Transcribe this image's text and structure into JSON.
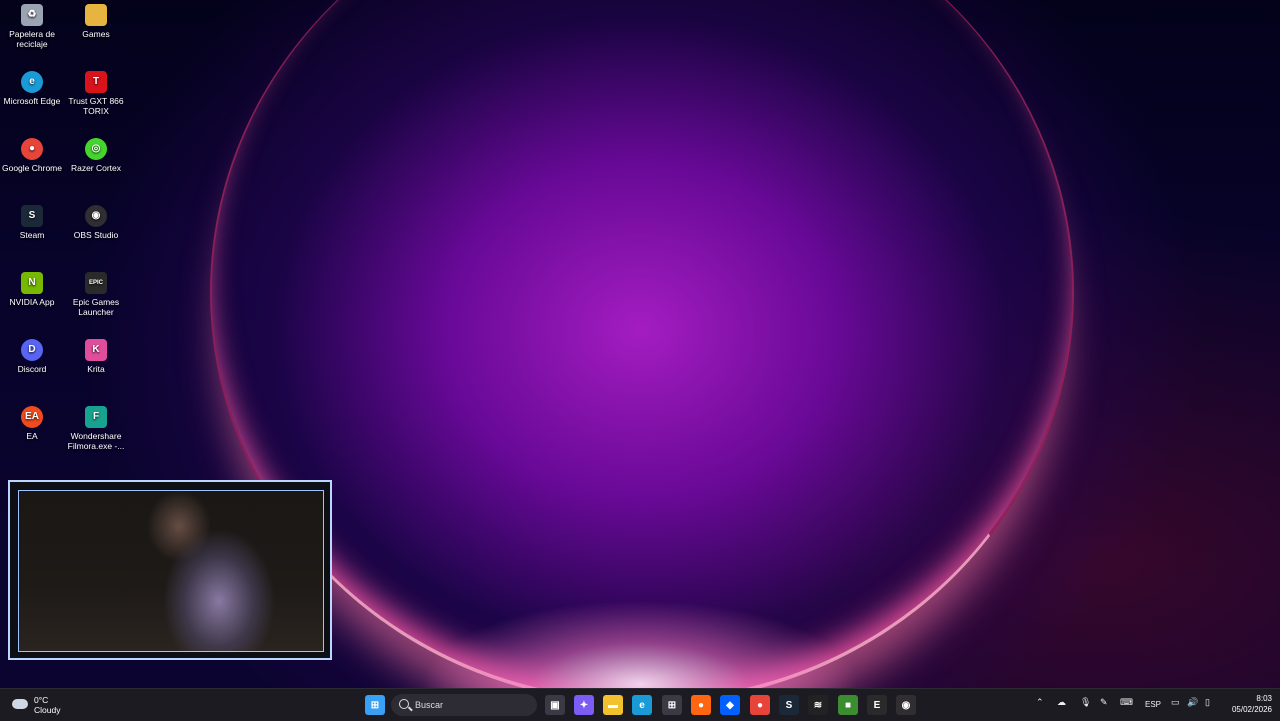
{
  "desktop_icons": [
    {
      "id": "recycle",
      "label": "Papelera de\nreciclaje",
      "icon": "recycle-bin-icon",
      "color": "#9aa4b3"
    },
    {
      "id": "games",
      "label": "Games",
      "icon": "folder-icon",
      "color": "#e8b440"
    },
    {
      "id": "edge",
      "label": "Microsoft Edge",
      "icon": "edge-icon",
      "color": "#1a9bd7"
    },
    {
      "id": "trust",
      "label": "Trust GXT 866\nTORIX",
      "icon": "trust-icon",
      "color": "#d8131c"
    },
    {
      "id": "chrome",
      "label": "Google Chrome",
      "icon": "chrome-icon",
      "color": "#e7453a"
    },
    {
      "id": "razer",
      "label": "Razer Cortex",
      "icon": "razer-cortex-icon",
      "color": "#44d62c"
    },
    {
      "id": "steam",
      "label": "Steam",
      "icon": "steam-icon",
      "color": "#1b2838"
    },
    {
      "id": "obs",
      "label": "OBS Studio",
      "icon": "obs-icon",
      "color": "#302e31"
    },
    {
      "id": "nvidia",
      "label": "NVIDIA App",
      "icon": "nvidia-icon",
      "color": "#76b900"
    },
    {
      "id": "epic",
      "label": "Epic Games\nLauncher",
      "icon": "epic-games-icon",
      "color": "#2a2a2a"
    },
    {
      "id": "discord",
      "label": "Discord",
      "icon": "discord-icon",
      "color": "#5865f2"
    },
    {
      "id": "krita",
      "label": "Krita",
      "icon": "krita-icon",
      "color": "#e04e9b"
    },
    {
      "id": "ea",
      "label": "EA",
      "icon": "ea-icon",
      "color": "#f04a1e"
    },
    {
      "id": "filmora",
      "label": "Wondershare\nFilmora.exe -...",
      "icon": "filmora-icon",
      "color": "#17a38f"
    }
  ],
  "icon_glyphs": {
    "recycle": "♻",
    "games": "",
    "edge": "e",
    "trust": "T",
    "chrome": "●",
    "razer": "◎",
    "steam": "S",
    "obs": "◉",
    "nvidia": "N",
    "epic": "EPIC",
    "discord": "D",
    "krita": "K",
    "ea": "EA",
    "filmora": "F"
  },
  "taskbar": {
    "weather": {
      "temp": "0°C",
      "condition": "Cloudy"
    },
    "search_placeholder": "Buscar",
    "apps": [
      {
        "name": "start-button",
        "icon": "windows-icon",
        "color": "#3aa0f3",
        "glyph": "⊞"
      },
      {
        "name": "task-view",
        "icon": "task-view-icon",
        "color": "#3a3944",
        "glyph": "▣"
      },
      {
        "name": "copilot",
        "icon": "copilot-icon",
        "color": "#7b5cf5",
        "glyph": "✦"
      },
      {
        "name": "file-explorer",
        "icon": "folder-icon",
        "color": "#f2c12e",
        "glyph": "▬"
      },
      {
        "name": "edge",
        "icon": "edge-icon",
        "color": "#1a9bd7",
        "glyph": "e"
      },
      {
        "name": "store",
        "icon": "store-icon",
        "color": "#3a3944",
        "glyph": "⊞"
      },
      {
        "name": "firefox",
        "icon": "firefox-icon",
        "color": "#ff6611",
        "glyph": "●"
      },
      {
        "name": "dropbox",
        "icon": "dropbox-icon",
        "color": "#0061fe",
        "glyph": "◆"
      },
      {
        "name": "chrome",
        "icon": "chrome-icon",
        "color": "#e7453a",
        "glyph": "●"
      },
      {
        "name": "steam",
        "icon": "steam-icon",
        "color": "#1b2838",
        "glyph": "S"
      },
      {
        "name": "razer",
        "icon": "razer-icon",
        "color": "#222",
        "glyph": "≋"
      },
      {
        "name": "minecraft",
        "icon": "minecraft-icon",
        "color": "#3c8d2f",
        "glyph": "■"
      },
      {
        "name": "epic",
        "icon": "epic-games-icon",
        "color": "#2a2a2a",
        "glyph": "E"
      },
      {
        "name": "obs",
        "icon": "obs-icon",
        "color": "#302e31",
        "glyph": "◉"
      }
    ],
    "tray": {
      "language": "ESP",
      "time": "8:03",
      "date": "05/02/2026"
    }
  }
}
